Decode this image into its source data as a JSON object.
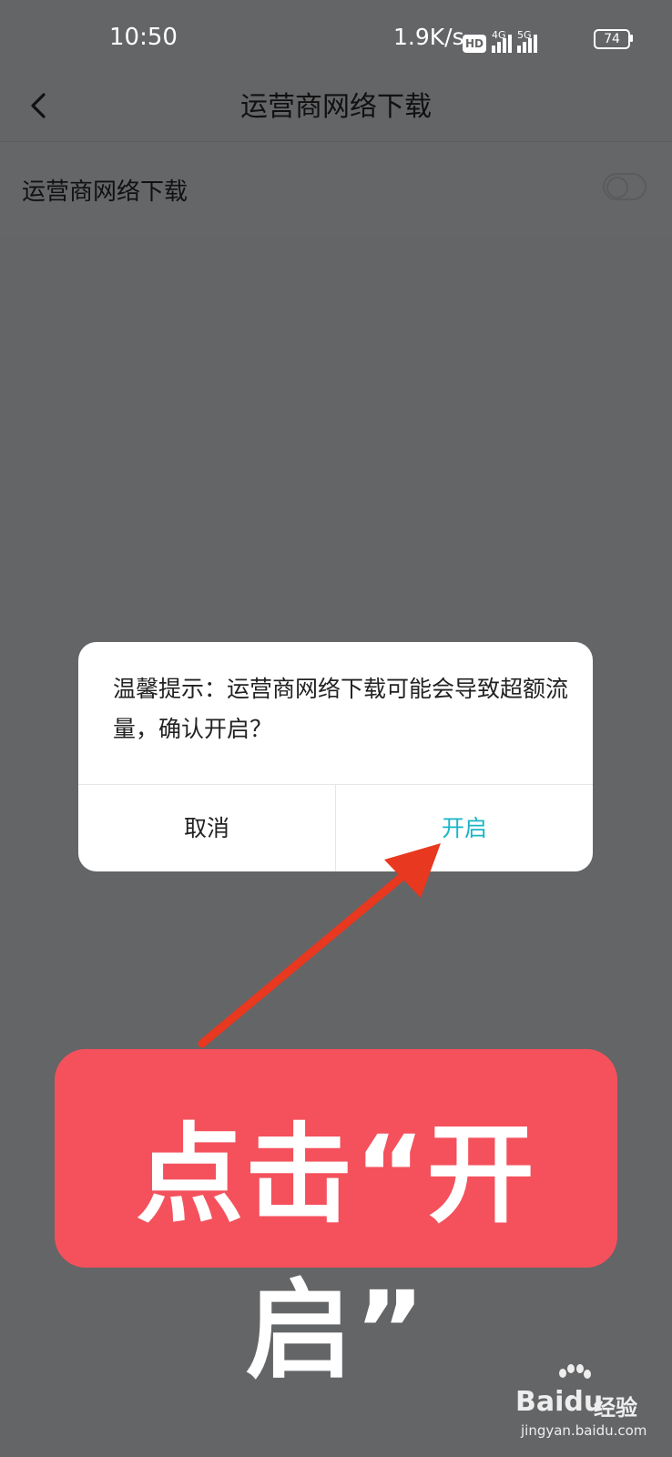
{
  "status_bar": {
    "time": "10:50",
    "net_speed": "1.9K/s",
    "hd_badge": "HD",
    "net1": "4G",
    "net2": "5G",
    "battery": "74"
  },
  "header": {
    "title": "运营商网络下载",
    "back_icon": "chevron-left-icon"
  },
  "setting": {
    "label": "运营商网络下载",
    "toggle_on": false
  },
  "dialog": {
    "message": "温馨提示：运营商网络下载可能会导致超额流量，确认开启？",
    "cancel_label": "取消",
    "confirm_label": "开启",
    "confirm_color": "#1ab6c6"
  },
  "annotation": {
    "callout_text": "点击“开启”",
    "callout_color": "#f4515c",
    "arrow_color": "#e8381f"
  },
  "watermark": {
    "logo": "Bai",
    "logo_du": "du",
    "word": "经验",
    "url": "jingyan.baidu.com"
  }
}
